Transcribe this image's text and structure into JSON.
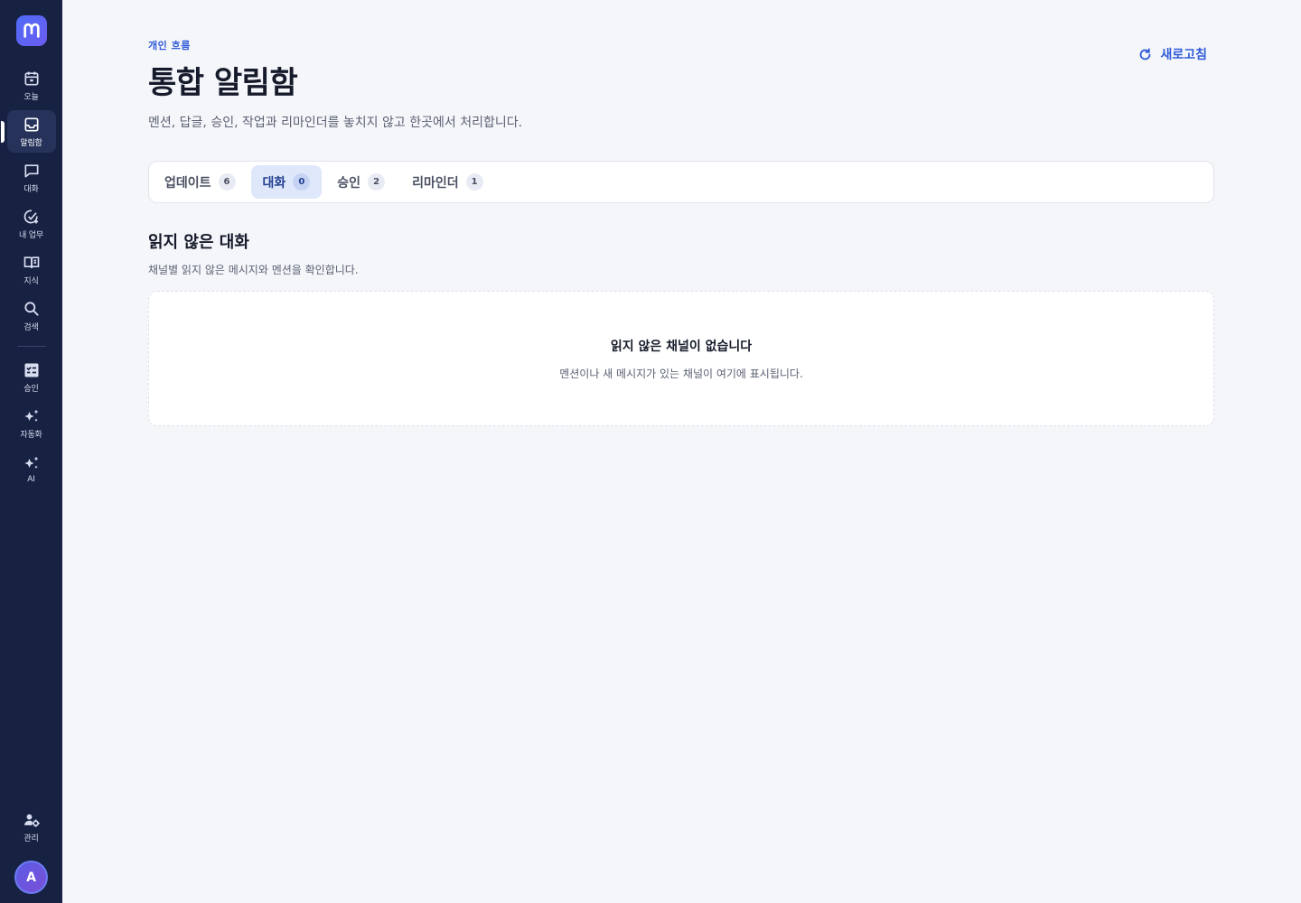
{
  "sidebar": {
    "logo": "M",
    "items": [
      {
        "label": "오늘",
        "icon": "calendar-icon"
      },
      {
        "label": "알림함",
        "icon": "inbox-icon"
      },
      {
        "label": "대화",
        "icon": "chat-icon"
      },
      {
        "label": "내 업무",
        "icon": "task-check-icon"
      },
      {
        "label": "지식",
        "icon": "book-icon"
      },
      {
        "label": "검색",
        "icon": "search-icon"
      },
      {
        "label": "승인",
        "icon": "approval-icon"
      },
      {
        "label": "자동화",
        "icon": "sparkle-icon"
      },
      {
        "label": "AI",
        "icon": "ai-sparkle-icon"
      }
    ],
    "admin_label": "관리",
    "avatar_initial": "A"
  },
  "header": {
    "eyebrow": "개인 흐름",
    "title": "통합 알림함",
    "description": "멘션, 답글, 승인, 작업과 리마인더를 놓치지 않고 한곳에서 처리합니다.",
    "refresh_label": "새로고침"
  },
  "tabs": [
    {
      "label": "업데이트",
      "count": "6"
    },
    {
      "label": "대화",
      "count": "0"
    },
    {
      "label": "승인",
      "count": "2"
    },
    {
      "label": "리마인더",
      "count": "1"
    }
  ],
  "section": {
    "title": "읽지 않은 대화",
    "description": "채널별 읽지 않은 메시지와 멘션을 확인합니다."
  },
  "empty_state": {
    "title": "읽지 않은 채널이 없습니다",
    "description": "멘션이나 새 메시지가 있는 채널이 여기에 표시됩니다."
  },
  "colors": {
    "sidebar_bg": "#172142",
    "accent": "#2f5bd8",
    "page_bg": "#f5f6fa"
  }
}
